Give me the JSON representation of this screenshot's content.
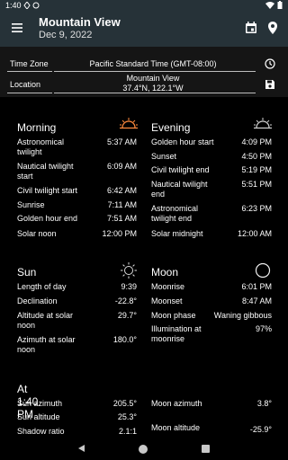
{
  "status": {
    "time": "1:40"
  },
  "app_bar": {
    "title": "Mountain View",
    "date": "Dec 9, 2022"
  },
  "info": {
    "tz_label": "Time Zone",
    "tz_value": "Pacific Standard Time (GMT-08:00)",
    "loc_label": "Location",
    "loc_name": "Mountain View",
    "loc_coords": "37.4°N, 122.1°W"
  },
  "morning": {
    "title": "Morning",
    "rows": [
      {
        "label": "Astronomical twilight",
        "value": "5:37 AM"
      },
      {
        "label": "Nautical twilight start",
        "value": "6:09 AM"
      },
      {
        "label": "Civil twilight start",
        "value": "6:42 AM"
      },
      {
        "label": "Sunrise",
        "value": "7:11 AM"
      },
      {
        "label": "Golden hour end",
        "value": "7:51 AM"
      },
      {
        "label": "Solar noon",
        "value": "12:00 PM"
      }
    ]
  },
  "evening": {
    "title": "Evening",
    "rows": [
      {
        "label": "Golden hour start",
        "value": "4:09 PM"
      },
      {
        "label": "Sunset",
        "value": "4:50 PM"
      },
      {
        "label": "Civil twilight end",
        "value": "5:19 PM"
      },
      {
        "label": "Nautical twilight end",
        "value": "5:51 PM"
      },
      {
        "label": "Astronomical twilight end",
        "value": "6:23 PM"
      },
      {
        "label": "Solar midnight",
        "value": "12:00 AM"
      }
    ]
  },
  "sun": {
    "title": "Sun",
    "rows": [
      {
        "label": "Length of day",
        "value": "9:39"
      },
      {
        "label": "Declination",
        "value": "-22.8°"
      },
      {
        "label": "Altitude at solar noon",
        "value": "29.7°"
      },
      {
        "label": "Azimuth at solar noon",
        "value": "180.0°"
      }
    ]
  },
  "moon": {
    "title": "Moon",
    "rows": [
      {
        "label": "Moonrise",
        "value": "6:01 PM"
      },
      {
        "label": "Moonset",
        "value": "8:47 AM"
      },
      {
        "label": "Moon phase",
        "value": "Waning gibbous"
      },
      {
        "label": "Illumination at moonrise",
        "value": "97%"
      }
    ]
  },
  "now": {
    "title": "At 1:40 PM",
    "rows": [
      {
        "label": "Sun azimuth",
        "value": "205.5°"
      },
      {
        "label": "Sun altitude",
        "value": "25.3°"
      },
      {
        "label": "Shadow ratio",
        "value": "2.1:1"
      }
    ],
    "moon_rows": [
      {
        "label": "Moon azimuth",
        "value": "3.8°"
      },
      {
        "label": "Moon altitude",
        "value": "-25.9°"
      }
    ]
  },
  "colors": {
    "app_bar": "#263238",
    "sun_icon_orange": "#ff8a3d",
    "background": "#000000"
  },
  "icons": [
    "menu-icon",
    "calendar-icon",
    "location-pin-icon",
    "clock-icon",
    "save-icon",
    "sunrise-icon",
    "sunset-icon",
    "sun-icon",
    "moon-icon"
  ]
}
